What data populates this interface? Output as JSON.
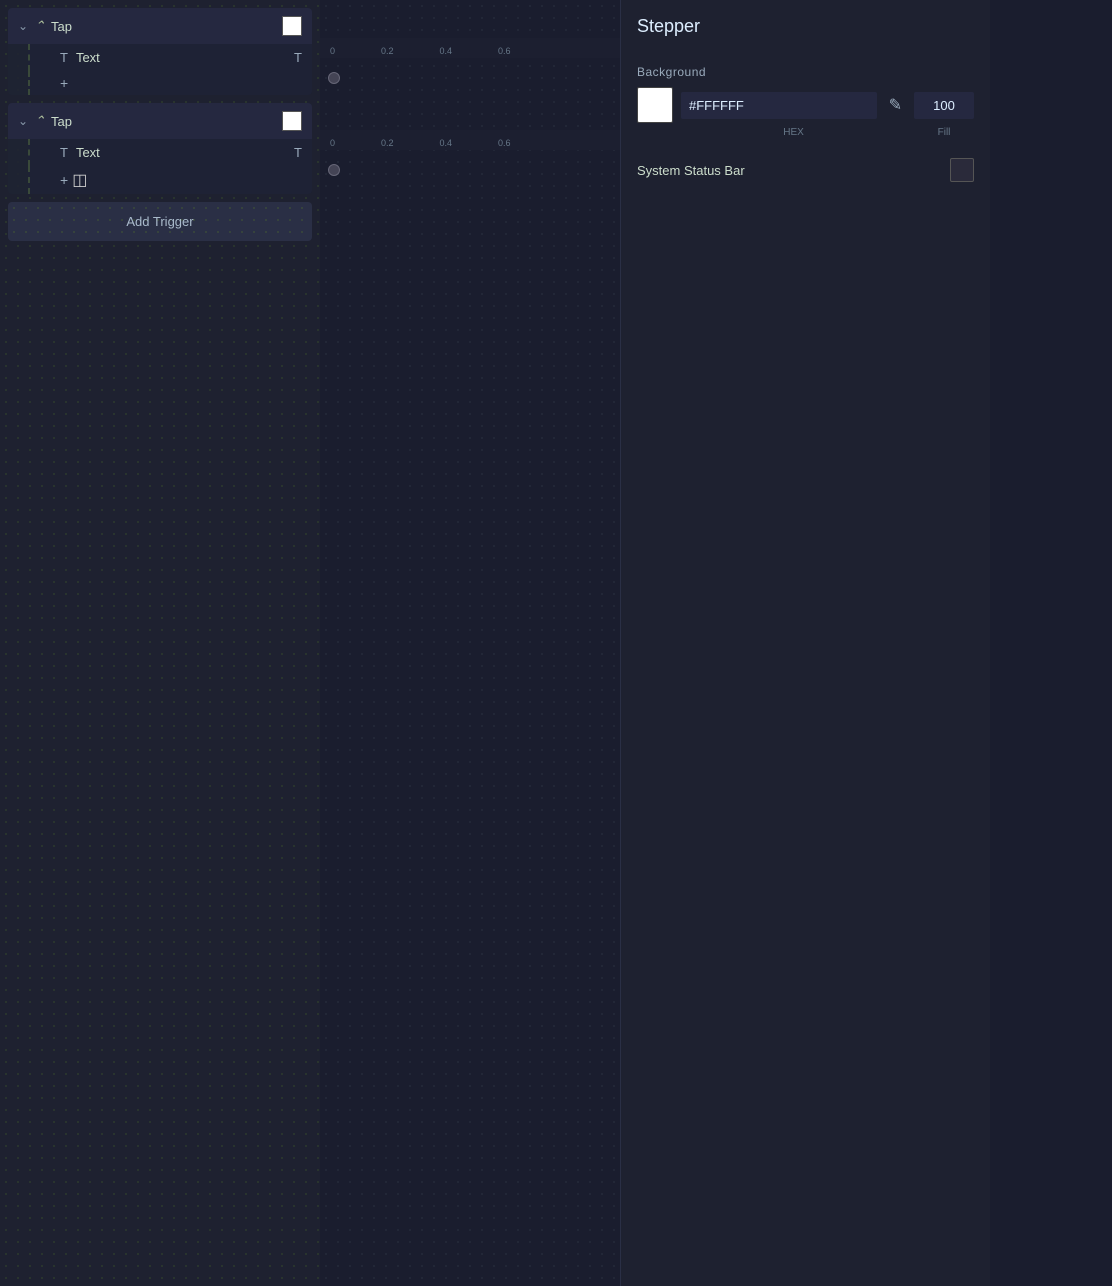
{
  "triggers": [
    {
      "id": "trigger-1",
      "type": "Tap",
      "expanded": true,
      "ruler": {
        "marks": [
          "0",
          "0.2",
          "0.4",
          "0.6"
        ]
      },
      "children": [
        {
          "id": "text-1",
          "label": "Text",
          "hasCircle": true
        }
      ]
    },
    {
      "id": "trigger-2",
      "type": "Tap",
      "expanded": true,
      "ruler": {
        "marks": [
          "0",
          "0.2",
          "0.4",
          "0.6"
        ]
      },
      "children": [
        {
          "id": "text-2",
          "label": "Text",
          "hasCircle": true
        }
      ]
    }
  ],
  "add_trigger_label": "Add Trigger",
  "panel": {
    "title": "Stepper",
    "background": {
      "label": "Background",
      "hex_label": "HEX",
      "fill_label": "Fill",
      "hex_value": "#FFFFFF",
      "fill_value": "100"
    },
    "system_status_bar": {
      "label": "System Status Bar"
    }
  },
  "icons": {
    "chevron_down": "∨",
    "tap_icon": "⌃",
    "text_icon": "T",
    "plus_icon": "+",
    "eyedropper": "⌦"
  }
}
